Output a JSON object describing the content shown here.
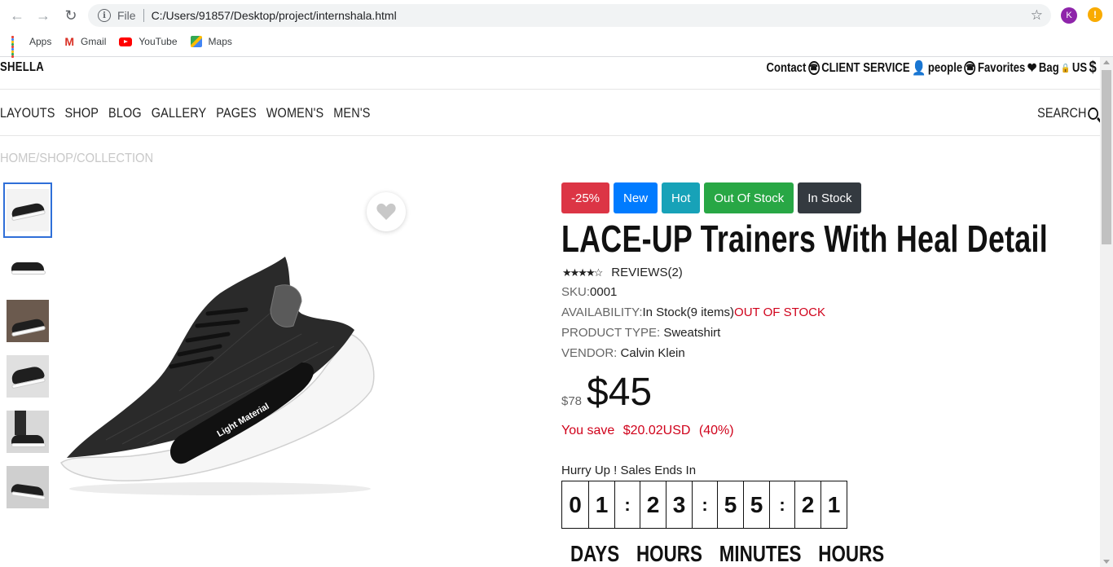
{
  "browser": {
    "scheme": "File",
    "url": "C:/Users/91857/Desktop/project/internshala.html",
    "profile_initial": "K",
    "alert_symbol": "!",
    "bookmarks": [
      {
        "label": "Apps",
        "icon": "apps-grid-icon"
      },
      {
        "label": "Gmail",
        "icon": "gmail-icon"
      },
      {
        "label": "YouTube",
        "icon": "youtube-icon"
      },
      {
        "label": "Maps",
        "icon": "maps-icon"
      }
    ]
  },
  "site": {
    "brand": "SHELLA",
    "top_links": {
      "contact": "Contact",
      "client_service": "CLIENT SERVICE",
      "people": "people",
      "favorites": "Favorites",
      "bag": "Bag",
      "currency": "US"
    },
    "menu": [
      "LAYOUTS",
      "SHOP",
      "BLOG",
      "GALLERY",
      "PAGES",
      "WOMEN'S",
      "MEN'S"
    ],
    "search": "SEARCH",
    "breadcrumb": "HOME/SHOP/COLLECTION"
  },
  "product": {
    "badges": [
      {
        "label": "-25%",
        "color": "#dc3545"
      },
      {
        "label": "New",
        "color": "#007bff"
      },
      {
        "label": "Hot",
        "color": "#17a2b8"
      },
      {
        "label": "Out Of Stock",
        "color": "#28a745"
      },
      {
        "label": "In Stock",
        "color": "#343a40"
      }
    ],
    "title": "LACE-UP Trainers With Heal Detail",
    "rating": 4.5,
    "reviews": "REVIEWS(2)",
    "sku_label": "SKU:",
    "sku": "0001",
    "availability_label": "AVAILABILITY:",
    "availability": "In Stock(9 items)",
    "availability_status": "OUT OF STOCK",
    "product_type_label": "PRODUCT TYPE:",
    "product_type": "Sweatshirt",
    "vendor_label": "VENDOR:",
    "vendor": "Calvin Klein",
    "old_price": "$78",
    "price": "$45",
    "save_label": "You save",
    "save_amount": "$20.02USD",
    "save_percent": "(40%)",
    "image_text": "Light Material"
  },
  "countdown": {
    "heading": "Hurry Up ! Sales Ends In",
    "cells": [
      "0",
      "1",
      ":",
      "2",
      "3",
      ":",
      "5",
      "5",
      ":",
      "2",
      "1"
    ],
    "units": [
      "DAYS",
      "HOURS",
      "MINUTES",
      "HOURS"
    ]
  }
}
